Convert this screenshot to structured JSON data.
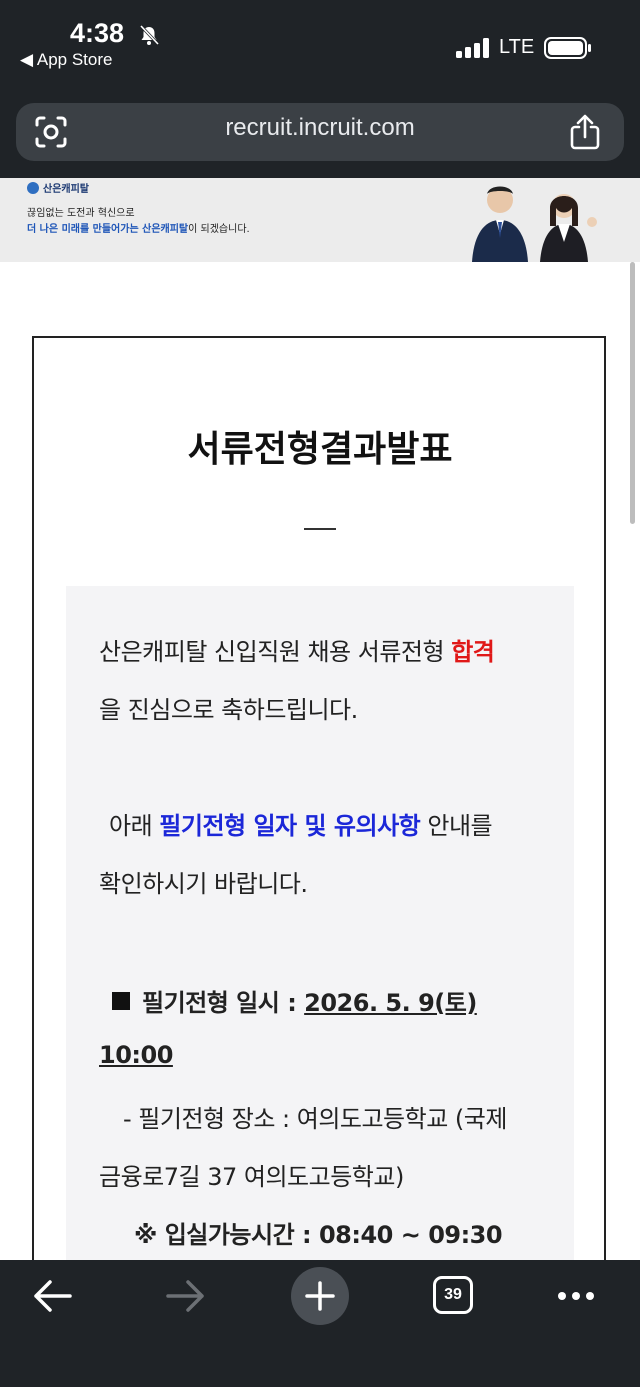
{
  "status": {
    "time": "4:38",
    "back_app": "◀ App Store",
    "network": "LTE"
  },
  "browser": {
    "url": "recruit.incruit.com",
    "tab_count": "39"
  },
  "banner": {
    "brand": "산은캐피탈",
    "line1": "끊임없는 도전과 혁신으로",
    "line2_highlight": "더 나은 미래를 만들어가는 산은캐피탈",
    "line2_rest": "이 되겠습니다."
  },
  "notice": {
    "title": "서류전형결과발표",
    "p1_a": "산은캐피탈 신입직원 채용 서류전형 ",
    "p1_red": "합격",
    "p1_b": "을 진심으로 축하드립니다.",
    "p2_pre": "아래 ",
    "p2_blue": "필기전형 일자 및 유의사항",
    "p2_post": " 안내를",
    "p2_b": "확인하시기 바랍니다.",
    "exam_label": "필기전형 일시 : ",
    "exam_date": "2026. 5. 9(토)",
    "exam_time": "10:00",
    "place_a": "- 필기전형 장소 : 여의도고등학교 (국제",
    "place_b": "금융로7길 37 여의도고등학교)",
    "entry": "※ 입실가능시간 : 08:40 ~ 09:30"
  },
  "colors": {
    "chrome": "#1f2327",
    "highlight_red": "#e01818",
    "highlight_blue": "#1b27d8"
  }
}
